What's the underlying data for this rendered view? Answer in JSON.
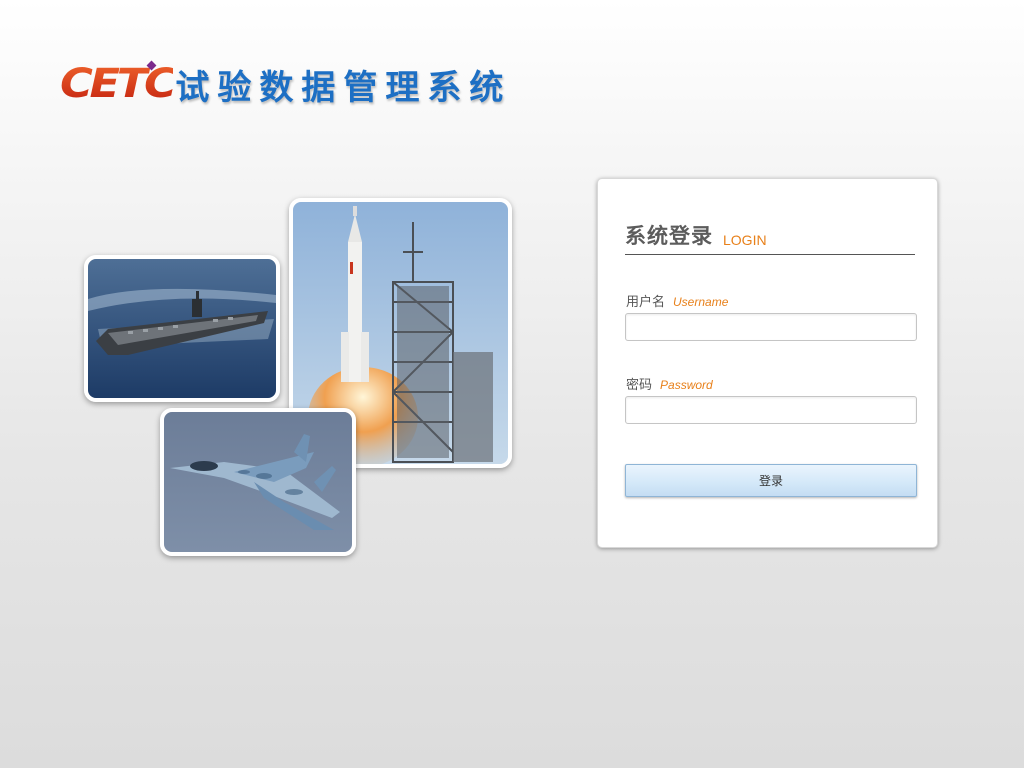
{
  "header": {
    "logo_text": "CETC",
    "system_title": "试验数据管理系统"
  },
  "photos": {
    "carrier_icon": "aircraft-carrier-photo",
    "rocket_icon": "rocket-launch-photo",
    "jet_icon": "fighter-jet-photo"
  },
  "login": {
    "heading_cn": "系统登录",
    "heading_en": "LOGIN",
    "username_label_cn": "用户名",
    "username_label_en": "Username",
    "username_value": "",
    "password_label_cn": "密码",
    "password_label_en": "Password",
    "password_value": "",
    "submit_label": "登录"
  },
  "colors": {
    "brand_red": "#d8401a",
    "title_blue": "#1d6fc4",
    "accent_orange": "#e8801a",
    "button_blue": "#d5e9f9"
  }
}
